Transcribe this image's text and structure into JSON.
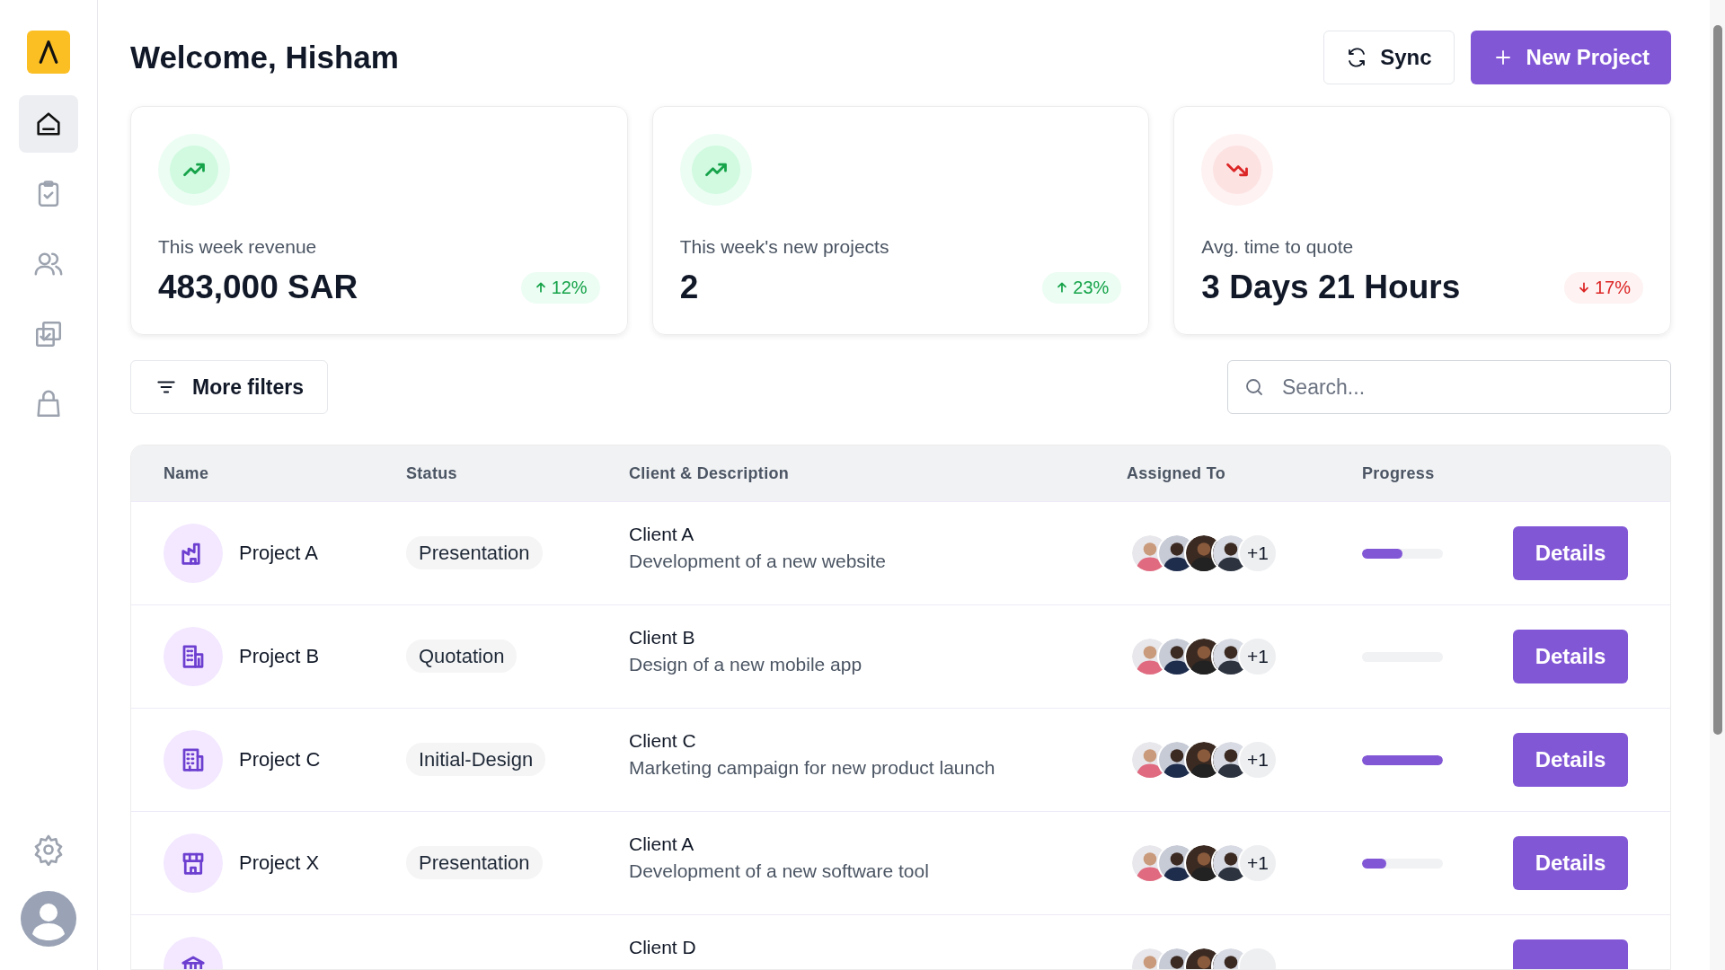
{
  "sidebar": {
    "items": [
      {
        "kind": "home",
        "selected": true
      },
      {
        "kind": "clipboard",
        "selected": false
      },
      {
        "kind": "users",
        "selected": false
      },
      {
        "kind": "copy",
        "selected": false
      },
      {
        "kind": "bag",
        "selected": false
      }
    ]
  },
  "header": {
    "title": "Welcome, Hisham",
    "buttons": [
      {
        "kind": "secondary",
        "label": "Sync"
      },
      {
        "kind": "primary",
        "label": "New Project"
      }
    ]
  },
  "stats": [
    {
      "label": "This week revenue",
      "value": "483,000 SAR",
      "kind": "up",
      "change": "12%"
    },
    {
      "label": "This week's new projects",
      "value": "2",
      "kind": "up",
      "change": "23%"
    },
    {
      "label": "Avg. time to quote",
      "value": "3 Days 21 Hours",
      "kind": "down",
      "change": "17%"
    }
  ],
  "filters": {
    "button": "More filters",
    "search": {
      "placeholder": "Search..."
    }
  },
  "table": {
    "columns": [
      "Name",
      "Status",
      "Client & Description",
      "Assigned To",
      "Progress"
    ],
    "rows": [
      {
        "kind": "factory",
        "name": "Project A",
        "status": "Presentation",
        "client": "Client A",
        "description": "Development of a new website",
        "more": "+1",
        "level": 0.5,
        "action": "Details"
      },
      {
        "kind": "building",
        "name": "Project B",
        "status": "Quotation",
        "client": "Client B",
        "description": "Design of a new mobile app",
        "more": "+1",
        "level": 0,
        "action": "Details"
      },
      {
        "kind": "office",
        "name": "Project C",
        "status": "Initial-Design",
        "client": "Client C",
        "description": "Marketing campaign for new product launch",
        "more": "+1",
        "level": 1,
        "action": "Details"
      },
      {
        "kind": "store",
        "name": "Project X",
        "status": "Presentation",
        "client": "Client A",
        "description": "Development of a new software tool",
        "more": "+1",
        "level": 0.3,
        "action": "Details"
      },
      {
        "kind": "bank",
        "client": "Client D"
      }
    ]
  }
}
